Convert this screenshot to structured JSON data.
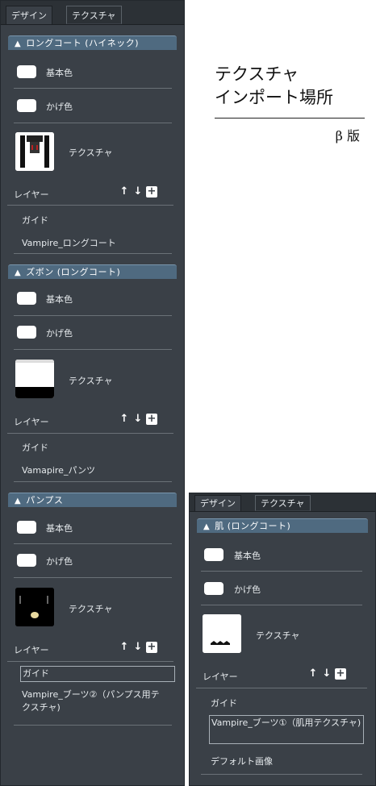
{
  "left_panel": {
    "tabs": {
      "design": "デザイン",
      "texture": "テクスチャ"
    },
    "sections": [
      {
        "header": "ロングコート (ハイネック)",
        "base_color": "基本色",
        "shadow_color": "かげ色",
        "texture": "テクスチャ",
        "layers_label": "レイヤー",
        "layers": [
          "ガイド",
          "Vampire_ロングコート"
        ]
      },
      {
        "header": "ズボン (ロングコート)",
        "base_color": "基本色",
        "shadow_color": "かげ色",
        "texture": "テクスチャ",
        "layers_label": "レイヤー",
        "layers": [
          "ガイド",
          "Vamapire_パンツ"
        ]
      },
      {
        "header": "パンプス",
        "base_color": "基本色",
        "shadow_color": "かげ色",
        "texture": "テクスチャ",
        "layers_label": "レイヤー",
        "layers": [
          "ガイド",
          "Vampire_ブーツ②（パンプス用テクスチャ)"
        ]
      }
    ]
  },
  "right_panel": {
    "tabs": {
      "design": "デザイン",
      "texture": "テクスチャ"
    },
    "section": {
      "header": "肌 (ロングコート)",
      "base_color": "基本色",
      "shadow_color": "かげ色",
      "texture": "テクスチャ",
      "layers_label": "レイヤー",
      "layers": [
        "ガイド",
        "Vampire_ブーツ①（肌用テクスチャ)",
        "デフォルト画像"
      ]
    }
  },
  "title": {
    "line1": "テクスチャ",
    "line2": "インポート場所",
    "badge": "β 版"
  },
  "icons": {
    "collapse": "caret-up-icon",
    "up": "arrow-up-icon",
    "down": "arrow-down-icon",
    "add": "plus-icon"
  },
  "colors": {
    "panel": "#3a4047",
    "header": "#4f6a80",
    "swatch": "#ffffff"
  }
}
